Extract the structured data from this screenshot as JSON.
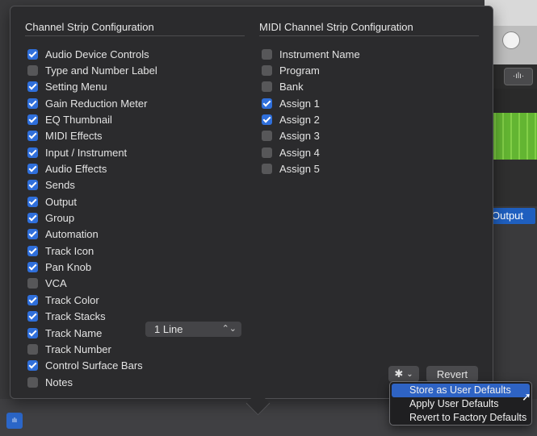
{
  "background": {
    "output_label": "Output",
    "wave_icon": "waveform-icon"
  },
  "left_section": {
    "title": "Channel Strip Configuration",
    "items": [
      {
        "label": "Audio Device Controls",
        "checked": true
      },
      {
        "label": "Type and Number Label",
        "checked": false
      },
      {
        "label": "Setting Menu",
        "checked": true
      },
      {
        "label": "Gain Reduction Meter",
        "checked": true
      },
      {
        "label": "EQ Thumbnail",
        "checked": true
      },
      {
        "label": "MIDI Effects",
        "checked": true
      },
      {
        "label": "Input / Instrument",
        "checked": true
      },
      {
        "label": "Audio Effects",
        "checked": true
      },
      {
        "label": "Sends",
        "checked": true
      },
      {
        "label": "Output",
        "checked": true
      },
      {
        "label": "Group",
        "checked": true
      },
      {
        "label": "Automation",
        "checked": true
      },
      {
        "label": "Track Icon",
        "checked": true
      },
      {
        "label": "Pan Knob",
        "checked": true
      },
      {
        "label": "VCA",
        "checked": false
      },
      {
        "label": "Track Color",
        "checked": true
      },
      {
        "label": "Track Stacks",
        "checked": true
      },
      {
        "label": "Track Name",
        "checked": true
      },
      {
        "label": "Track Number",
        "checked": false
      },
      {
        "label": "Control Surface Bars",
        "checked": true
      },
      {
        "label": "Notes",
        "checked": false
      }
    ],
    "track_name_select": {
      "value": "1 Line",
      "chevron": "⌃⌄"
    }
  },
  "right_section": {
    "title": "MIDI Channel Strip Configuration",
    "items": [
      {
        "label": "Instrument Name",
        "checked": false
      },
      {
        "label": "Program",
        "checked": false
      },
      {
        "label": "Bank",
        "checked": false
      },
      {
        "label": "Assign 1",
        "checked": true
      },
      {
        "label": "Assign 2",
        "checked": true
      },
      {
        "label": "Assign 3",
        "checked": false
      },
      {
        "label": "Assign 4",
        "checked": false
      },
      {
        "label": "Assign 5",
        "checked": false
      }
    ]
  },
  "footer": {
    "gear_icon": "✱",
    "gear_chevron": "⌄",
    "revert_label": "Revert"
  },
  "menu": {
    "items": [
      {
        "label": "Store as User Defaults",
        "highlighted": true
      },
      {
        "label": "Apply User Defaults",
        "highlighted": false
      },
      {
        "label": "Revert to Factory Defaults",
        "highlighted": false
      }
    ]
  },
  "colors": {
    "accent": "#2f6fdb",
    "menu_highlight": "#2e63c4",
    "popover_bg": "#2b2b2d"
  }
}
